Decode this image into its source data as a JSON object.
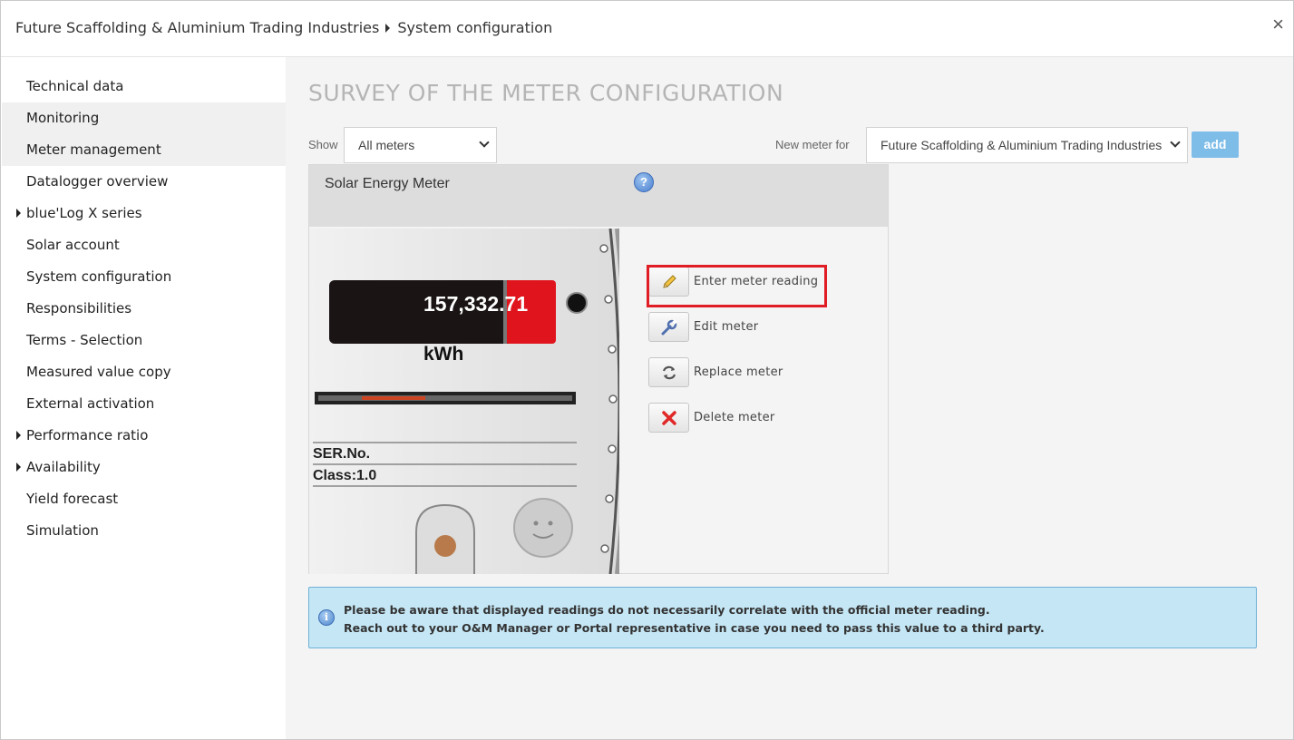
{
  "header": {
    "company": "Future Scaffolding & Aluminium Trading Industries",
    "page": "System configuration",
    "close_symbol": "×"
  },
  "sidebar": {
    "items": [
      {
        "label": "Technical data",
        "expandable": false
      },
      {
        "label": "Monitoring",
        "expandable": false
      },
      {
        "label": "Meter management",
        "expandable": false
      },
      {
        "label": "Datalogger overview",
        "expandable": false
      },
      {
        "label": "blue'Log X series",
        "expandable": true
      },
      {
        "label": "Solar account",
        "expandable": false
      },
      {
        "label": "System configuration",
        "expandable": false
      },
      {
        "label": "Responsibilities",
        "expandable": false
      },
      {
        "label": "Terms - Selection",
        "expandable": false
      },
      {
        "label": "Measured value copy",
        "expandable": false
      },
      {
        "label": "External activation",
        "expandable": false
      },
      {
        "label": "Performance ratio",
        "expandable": true
      },
      {
        "label": "Availability",
        "expandable": true
      },
      {
        "label": "Yield forecast",
        "expandable": false
      },
      {
        "label": "Simulation",
        "expandable": false
      }
    ]
  },
  "main": {
    "title": "SURVEY OF THE METER CONFIGURATION",
    "show_label": "Show",
    "show_value": "All meters",
    "new_meter_label": "New meter for",
    "new_meter_value": "Future Scaffolding & Aluminium Trading Industries",
    "add_label": "add"
  },
  "meter": {
    "title": "Solar Energy Meter",
    "help_symbol": "?",
    "reading": "157,332.71",
    "unit": "kWh",
    "serial_label": "SER.No.",
    "class_label": "Class:1.0"
  },
  "actions": {
    "enter_reading": "Enter meter reading",
    "edit": "Edit meter",
    "replace": "Replace meter",
    "delete": "Delete meter"
  },
  "notice": {
    "icon_symbol": "i",
    "line1": "Please be aware that displayed readings do not necessarily correlate with the official meter reading.",
    "line2": "Reach out to your O&M Manager or Portal representative in case you need to pass this value to a third party."
  },
  "colors": {
    "accent_button": "#7fbde9",
    "highlight": "#e01c24",
    "notice_bg": "#c5e6f5",
    "title_gray": "#b5b5b5"
  },
  "icons": {
    "help": "help-icon",
    "info": "info-icon",
    "enter": "pencil-icon",
    "edit": "wrench-icon",
    "replace": "refresh-icon",
    "delete": "x-icon"
  }
}
